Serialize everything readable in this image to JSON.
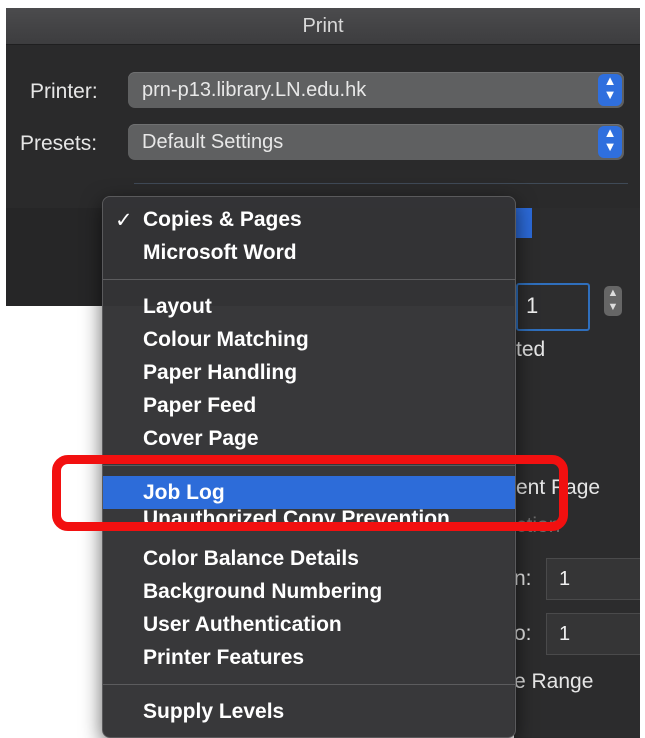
{
  "window": {
    "title": "Print"
  },
  "printer": {
    "label": "Printer:",
    "value": "prn-p13.library.LN.edu.hk"
  },
  "presets": {
    "label": "Presets:",
    "value": "Default Settings"
  },
  "stepper": {
    "up": "▲",
    "down": "▼"
  },
  "copies": {
    "value": "1",
    "partial_label": "ted"
  },
  "right_panel": {
    "current_page": "ent Page",
    "selection": "ction",
    "from_label": "n:",
    "from_value": "1",
    "to_label": "o:",
    "to_value": "1",
    "range_label": "e Range"
  },
  "menu": {
    "checkmark": "✓",
    "group1": [
      "Copies & Pages",
      "Microsoft Word"
    ],
    "group2": [
      "Layout",
      "Colour Matching",
      "Paper Handling",
      "Paper Feed",
      "Cover Page"
    ],
    "group3": [
      "Job Log",
      "Unauthorized Copy Prevention",
      "Color Balance Details",
      "Background Numbering",
      "User Authentication",
      "Printer Features"
    ],
    "group4": [
      "Supply Levels"
    ],
    "checked_item": "Copies & Pages",
    "highlighted_item": "Job Log"
  },
  "colors": {
    "accent": "#2d6cd9",
    "annotation": "#f21010",
    "menu_bg": "#343436"
  }
}
